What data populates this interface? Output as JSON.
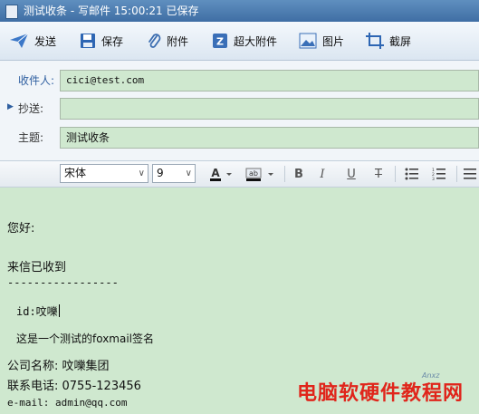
{
  "window": {
    "title": "测试收条 - 写邮件     15:00:21 已保存"
  },
  "toolbar": {
    "send": "发送",
    "save": "保存",
    "attach": "附件",
    "large_attach": "超大附件",
    "image": "图片",
    "screenshot": "截屏"
  },
  "header": {
    "to_label": "收件人:",
    "to_value": "cici@test.com",
    "cc_label": "抄送:",
    "cc_value": "",
    "subject_label": "主题:",
    "subject_value": "测试收条"
  },
  "format": {
    "font": "宋体",
    "size": "9"
  },
  "body": {
    "greeting": "您好:",
    "line1": "来信已收到",
    "divider": "-----------------",
    "id_line": "id:呅嚛",
    "sig_line": "这是一个测试的foxmail签名",
    "company": "公司名称: 呅嚛集团",
    "phone": "联系电话: 0755-123456",
    "email": "e-mail: admin@qq.com"
  },
  "watermark": {
    "text": "电脑软硬件教程网",
    "sub": "Anxz"
  },
  "colors": {
    "title_bar": "#4a7bb0",
    "body_bg": "#cfe8cf",
    "watermark": "#e0251b"
  }
}
